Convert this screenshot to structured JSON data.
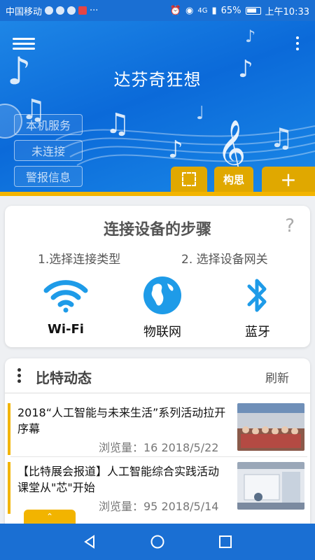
{
  "status_bar": {
    "carrier": "中国移动",
    "network": "4G",
    "battery": "65%",
    "time": "上午10:33"
  },
  "header": {
    "title": "达芬奇狂想",
    "side_buttons": [
      "本机服务",
      "未连接",
      "警报信息"
    ],
    "tab_idea": "构思",
    "tab_add": "+"
  },
  "steps": {
    "title": "连接设备的步骤",
    "help": "?",
    "step1": "1.选择连接类型",
    "step2": "2. 选择设备网关",
    "connections": [
      {
        "label": "Wi-Fi",
        "icon": "wifi-icon"
      },
      {
        "label": "物联网",
        "icon": "globe-icon"
      },
      {
        "label": "蓝牙",
        "icon": "bluetooth-icon"
      }
    ]
  },
  "news": {
    "title": "比特动态",
    "refresh": "刷新",
    "items": [
      {
        "title": "2018“人工智能与未来生活”系列活动拉开序幕",
        "meta": "浏览量：16  2018/5/22"
      },
      {
        "title": "【比特展会报道】人工智能综合实践活动课堂从\"芯\"开始",
        "meta": "浏览量：95  2018/5/14"
      }
    ]
  },
  "colors": {
    "primary_blue": "#1a6fd3",
    "accent_yellow": "#f2b400"
  }
}
